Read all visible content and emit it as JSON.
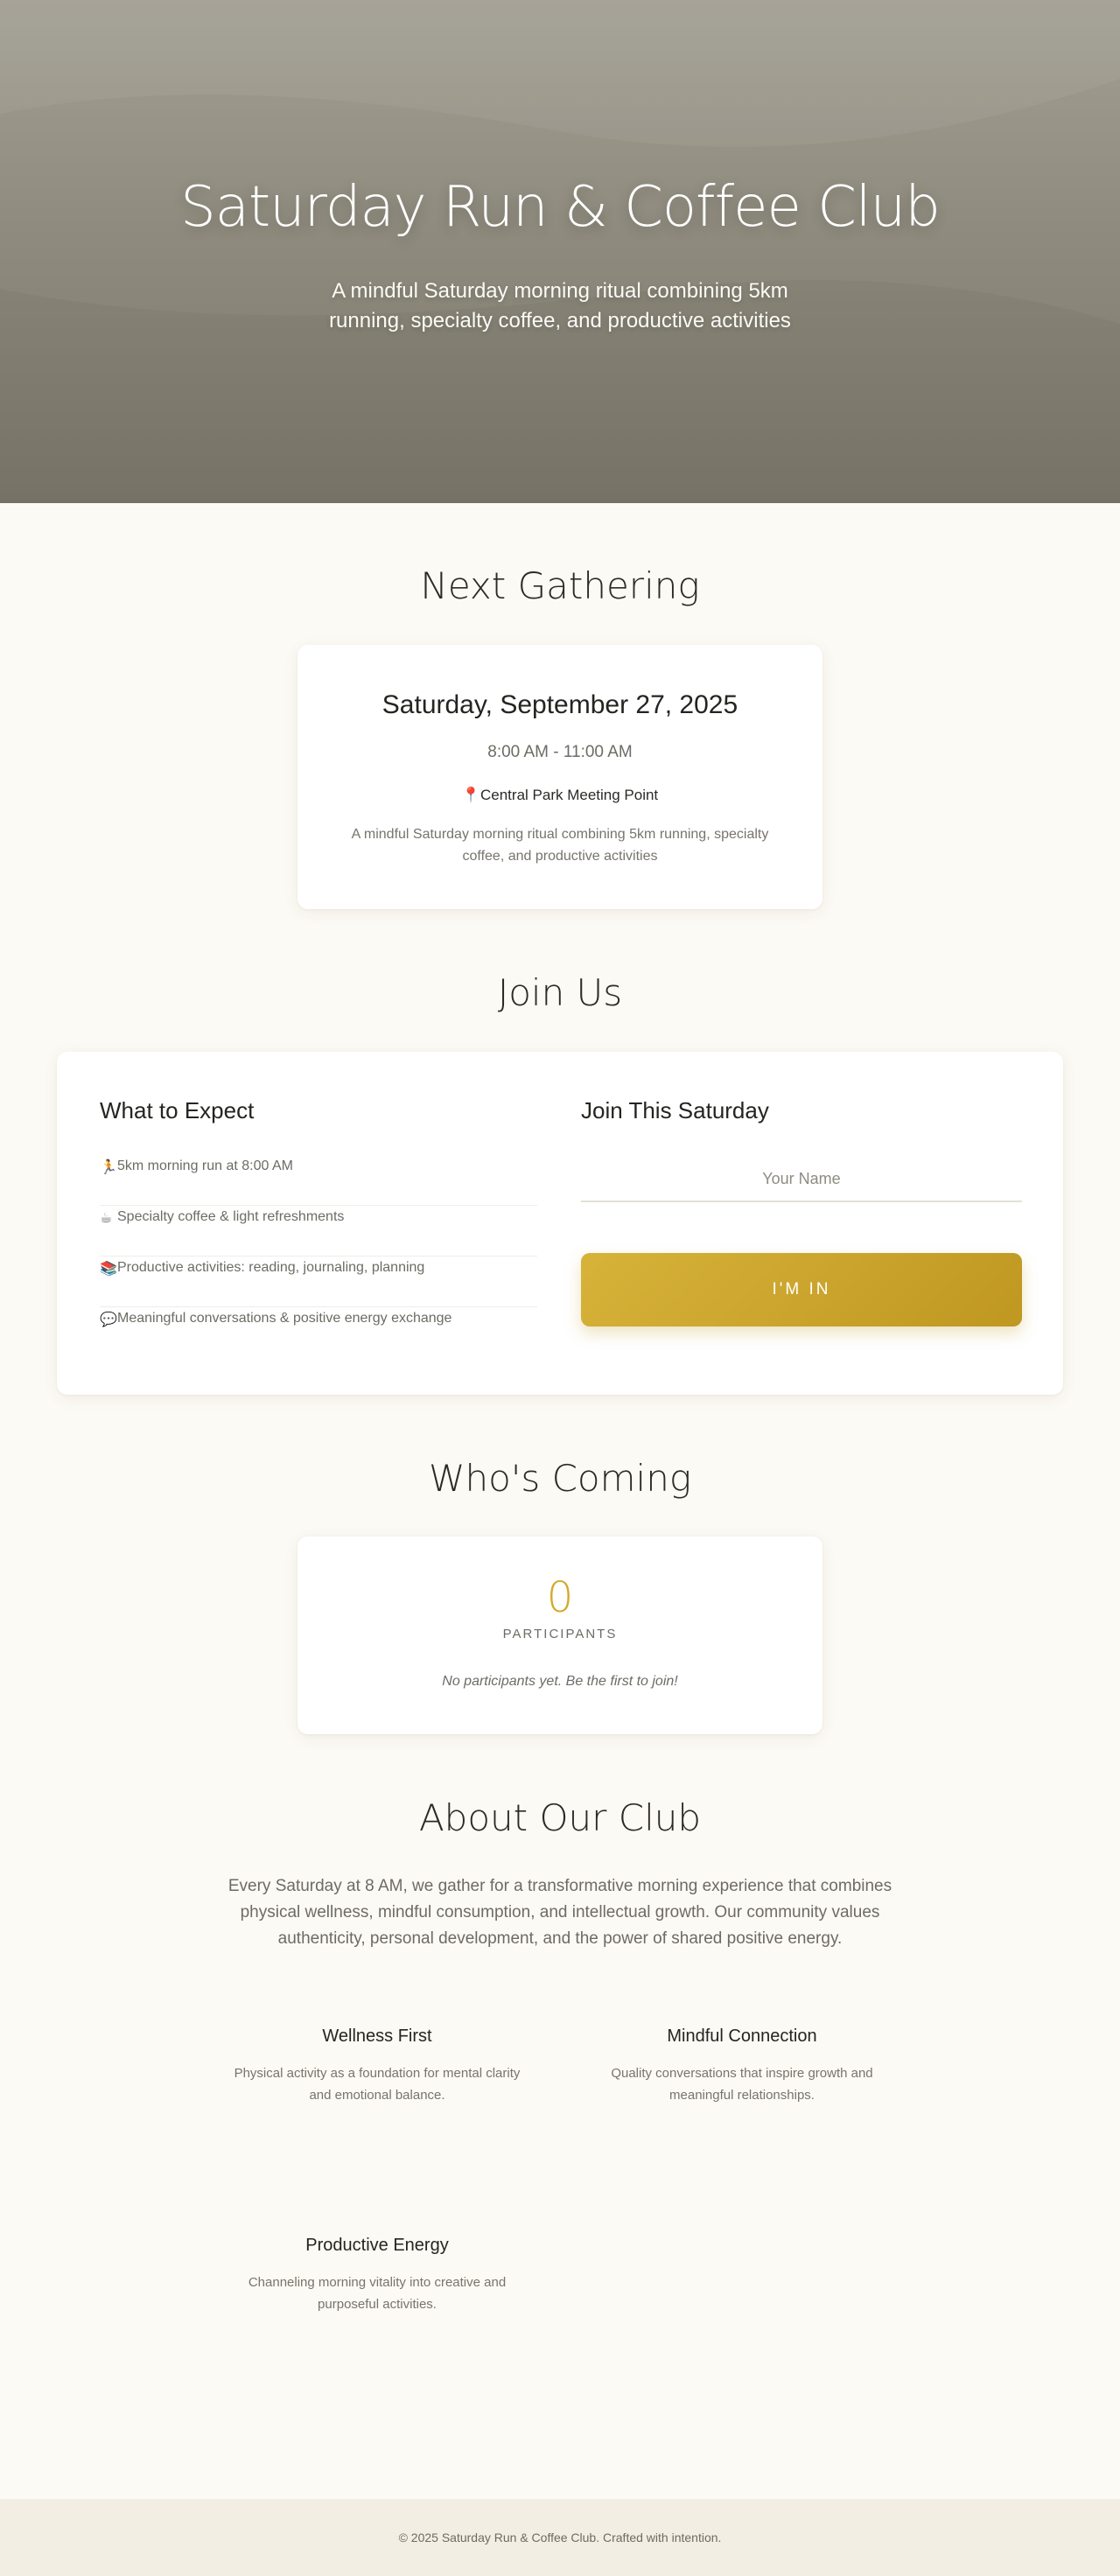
{
  "hero": {
    "title": "Saturday Run & Coffee Club",
    "subtitle": "A mindful Saturday morning ritual combining 5km running, specialty coffee, and productive activities"
  },
  "next_gathering": {
    "heading": "Next Gathering",
    "date": "Saturday, September 27, 2025",
    "time": "8:00 AM - 11:00 AM",
    "location_icon": "📍",
    "location": "Central Park Meeting Point",
    "description": "A mindful Saturday morning ritual combining 5km running, specialty coffee, and productive activities"
  },
  "join_us": {
    "heading": "Join Us",
    "expect": {
      "title": "What to Expect",
      "items": [
        {
          "icon": "🏃",
          "icon_name": "runner-icon",
          "label": "5km morning run at 8:00 AM"
        },
        {
          "icon": "☕",
          "icon_name": "coffee-icon",
          "label": "Specialty coffee & light refreshments"
        },
        {
          "icon": "📚",
          "icon_name": "books-icon",
          "label": "Productive activities: reading, journaling, planning"
        },
        {
          "icon": "💬",
          "icon_name": "speech-bubble-icon",
          "label": "Meaningful conversations & positive energy exchange"
        }
      ]
    },
    "form": {
      "title": "Join This Saturday",
      "name_placeholder": "Your Name",
      "name_value": "",
      "submit_label": "I'M IN"
    }
  },
  "whos_coming": {
    "heading": "Who's Coming",
    "count": "0",
    "count_label": "PARTICIPANTS",
    "empty_message": "No participants yet. Be the first to join!"
  },
  "about": {
    "heading": "About Our Club",
    "text": "Every Saturday at 8 AM, we gather for a transformative morning experience that combines physical wellness, mindful consumption, and intellectual growth. Our community values authenticity, personal development, and the power of shared positive energy.",
    "features": [
      {
        "title": "Wellness First",
        "text": "Physical activity as a foundation for mental clarity and emotional balance."
      },
      {
        "title": "Mindful Connection",
        "text": "Quality conversations that inspire growth and meaningful relationships."
      },
      {
        "title": "Productive Energy",
        "text": "Channeling morning vitality into creative and purposeful activities."
      }
    ]
  },
  "footer": {
    "text": "© 2025 Saturday Run & Coffee Club. Crafted with intention."
  },
  "colors": {
    "accent_gold": "#c9a22e",
    "hero_bg": "#8f8b7e",
    "page_bg": "#fcfaf4",
    "footer_bg": "#f3eee3"
  }
}
